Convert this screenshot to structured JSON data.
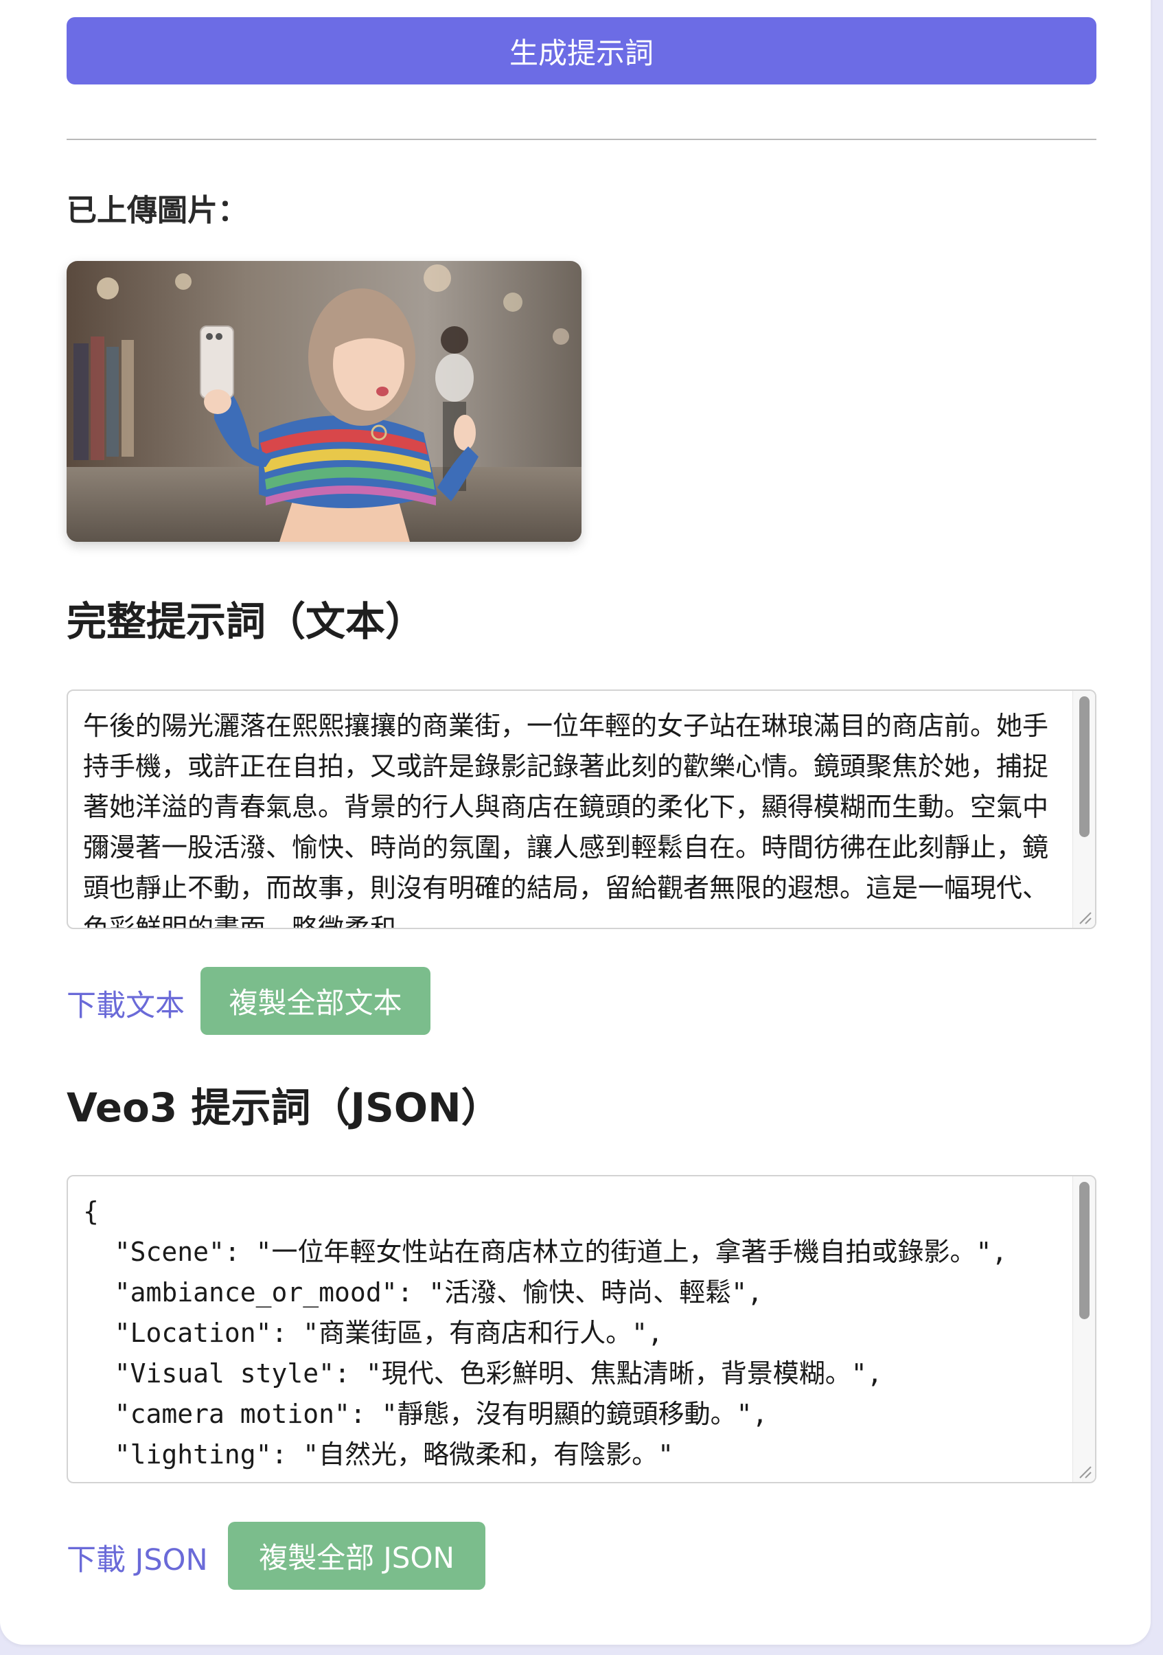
{
  "actions": {
    "generate_label": "生成提示詞"
  },
  "uploaded": {
    "label": "已上傳圖片："
  },
  "text_section": {
    "heading": "完整提示詞（文本）",
    "content": "午後的陽光灑落在熙熙攘攘的商業街，一位年輕的女子站在琳琅滿目的商店前。她手持手機，或許正在自拍，又或許是錄影記錄著此刻的歡樂心情。鏡頭聚焦於她，捕捉著她洋溢的青春氣息。背景的行人與商店在鏡頭的柔化下，顯得模糊而生動。空氣中彌漫著一股活潑、愉快、時尚的氛圍，讓人感到輕鬆自在。時間彷彿在此刻靜止，鏡頭也靜止不動，而故事，則沒有明確的結局，留給觀者無限的遐想。這是一幅現代、色彩鮮明的畫面，略微柔和",
    "download_label": "下載文本",
    "copy_label": "複製全部文本"
  },
  "json_section": {
    "heading": "Veo3 提示詞（JSON）",
    "content": "{\n  \"Scene\": \"一位年輕女性站在商店林立的街道上，拿著手機自拍或錄影。\",\n  \"ambiance_or_mood\": \"活潑、愉快、時尚、輕鬆\",\n  \"Location\": \"商業街區，有商店和行人。\",\n  \"Visual style\": \"現代、色彩鮮明、焦點清晰，背景模糊。\",\n  \"camera motion\": \"靜態，沒有明顯的鏡頭移動。\",\n  \"lighting\": \"自然光，略微柔和，有陰影。\"",
    "download_label": "下載 JSON",
    "copy_label": "複製全部 JSON"
  },
  "colors": {
    "primary": "#6c6ce5",
    "copy_button": "#7bbd8c",
    "link": "#6a6ad8",
    "page_bg": "#e6e6f7"
  }
}
